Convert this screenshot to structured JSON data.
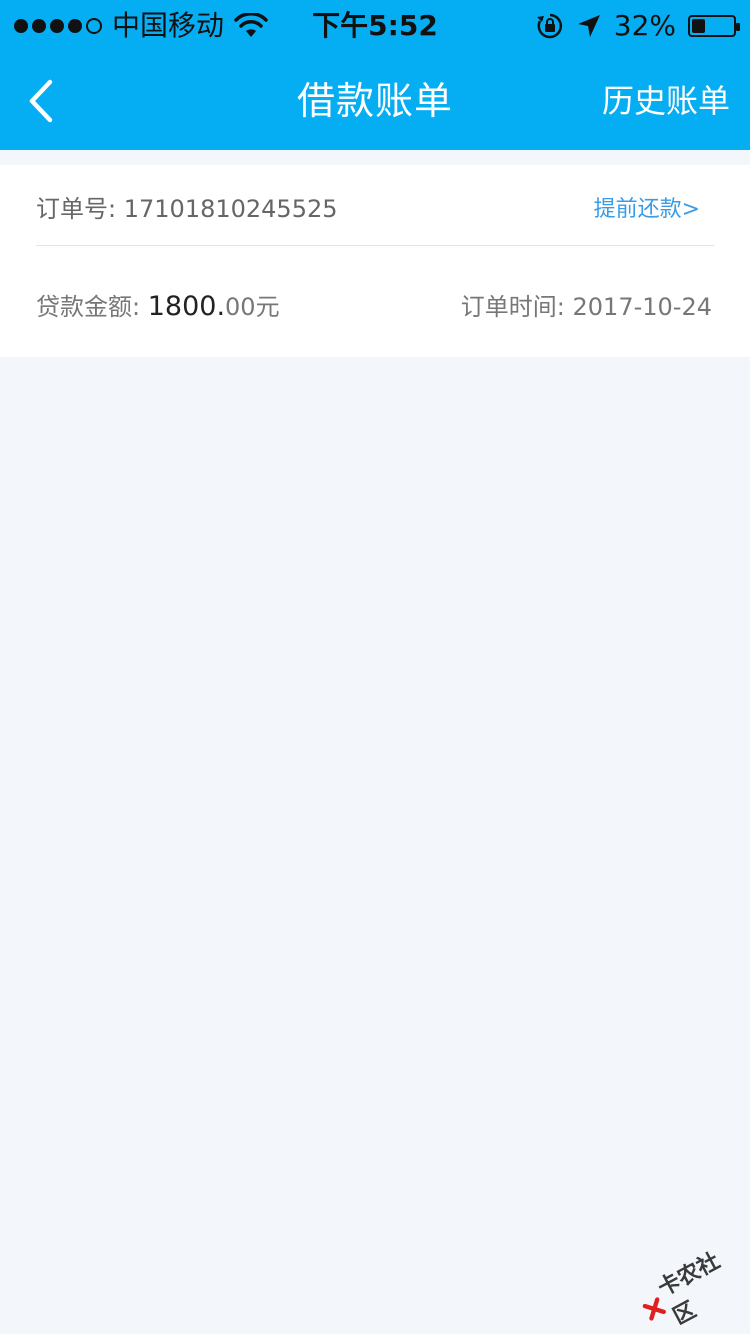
{
  "status_bar": {
    "carrier": "中国移动",
    "time": "下午5:52",
    "battery": "32%",
    "battery_level": 0.32
  },
  "nav": {
    "title": "借款账单",
    "right_link": "历史账单"
  },
  "bill": {
    "order_label": "订单号:",
    "order_number": "17101810245525",
    "prepay_link": "提前还款>",
    "amount_label": "贷款金额:",
    "amount_integer": "1800.",
    "amount_decimal": "00",
    "amount_unit": "元",
    "order_time_label": "订单时间:",
    "order_time": "2017-10-24"
  },
  "watermark": {
    "text": "卡农社区"
  },
  "colors": {
    "primary": "#05adf2",
    "link": "#3a9ce6",
    "background": "#f3f7fb"
  }
}
